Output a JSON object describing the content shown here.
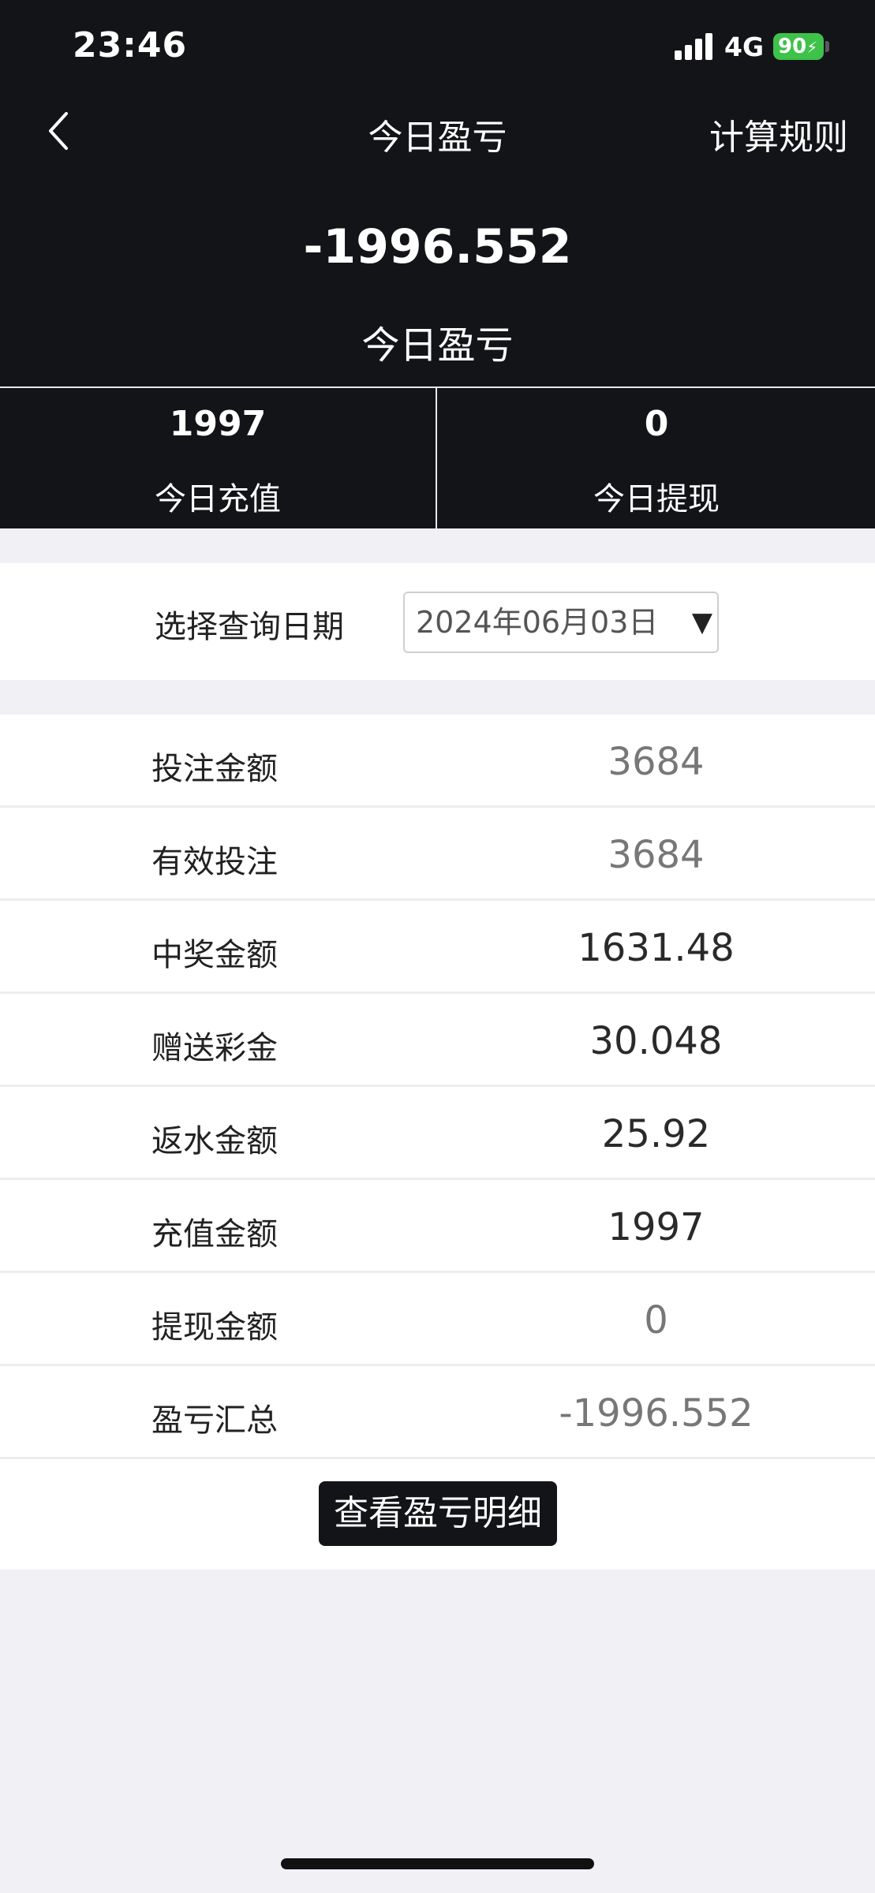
{
  "status_bar": {
    "time": "23:46",
    "network": "4G",
    "battery": "90"
  },
  "nav": {
    "title": "今日盈亏",
    "rules_link": "计算规则"
  },
  "summary": {
    "amount": "-1996.552",
    "label": "今日盈亏"
  },
  "split": {
    "recharge_value": "1997",
    "recharge_label": "今日充值",
    "withdraw_value": "0",
    "withdraw_label": "今日提现"
  },
  "date_query": {
    "label": "选择查询日期",
    "selected": "2024年06月03日"
  },
  "stats": [
    {
      "label": "投注金额",
      "value": "3684"
    },
    {
      "label": "有效投注",
      "value": "3684"
    },
    {
      "label": "中奖金额",
      "value": "1631.48"
    },
    {
      "label": "赠送彩金",
      "value": "30.048"
    },
    {
      "label": "返水金额",
      "value": "25.92"
    },
    {
      "label": "充值金额",
      "value": "1997"
    },
    {
      "label": "提现金额",
      "value": "0"
    },
    {
      "label": "盈亏汇总",
      "value": "-1996.552"
    }
  ],
  "detail_button": "查看盈亏明细",
  "icons": {
    "back": "chevron-left-icon",
    "dropdown": "triangle-down-icon",
    "signal": "cellular-signal-icon",
    "battery": "battery-icon"
  },
  "colors": {
    "header_bg": "#131418",
    "page_bg": "#f1f1f5",
    "battery": "#3ec24a"
  }
}
